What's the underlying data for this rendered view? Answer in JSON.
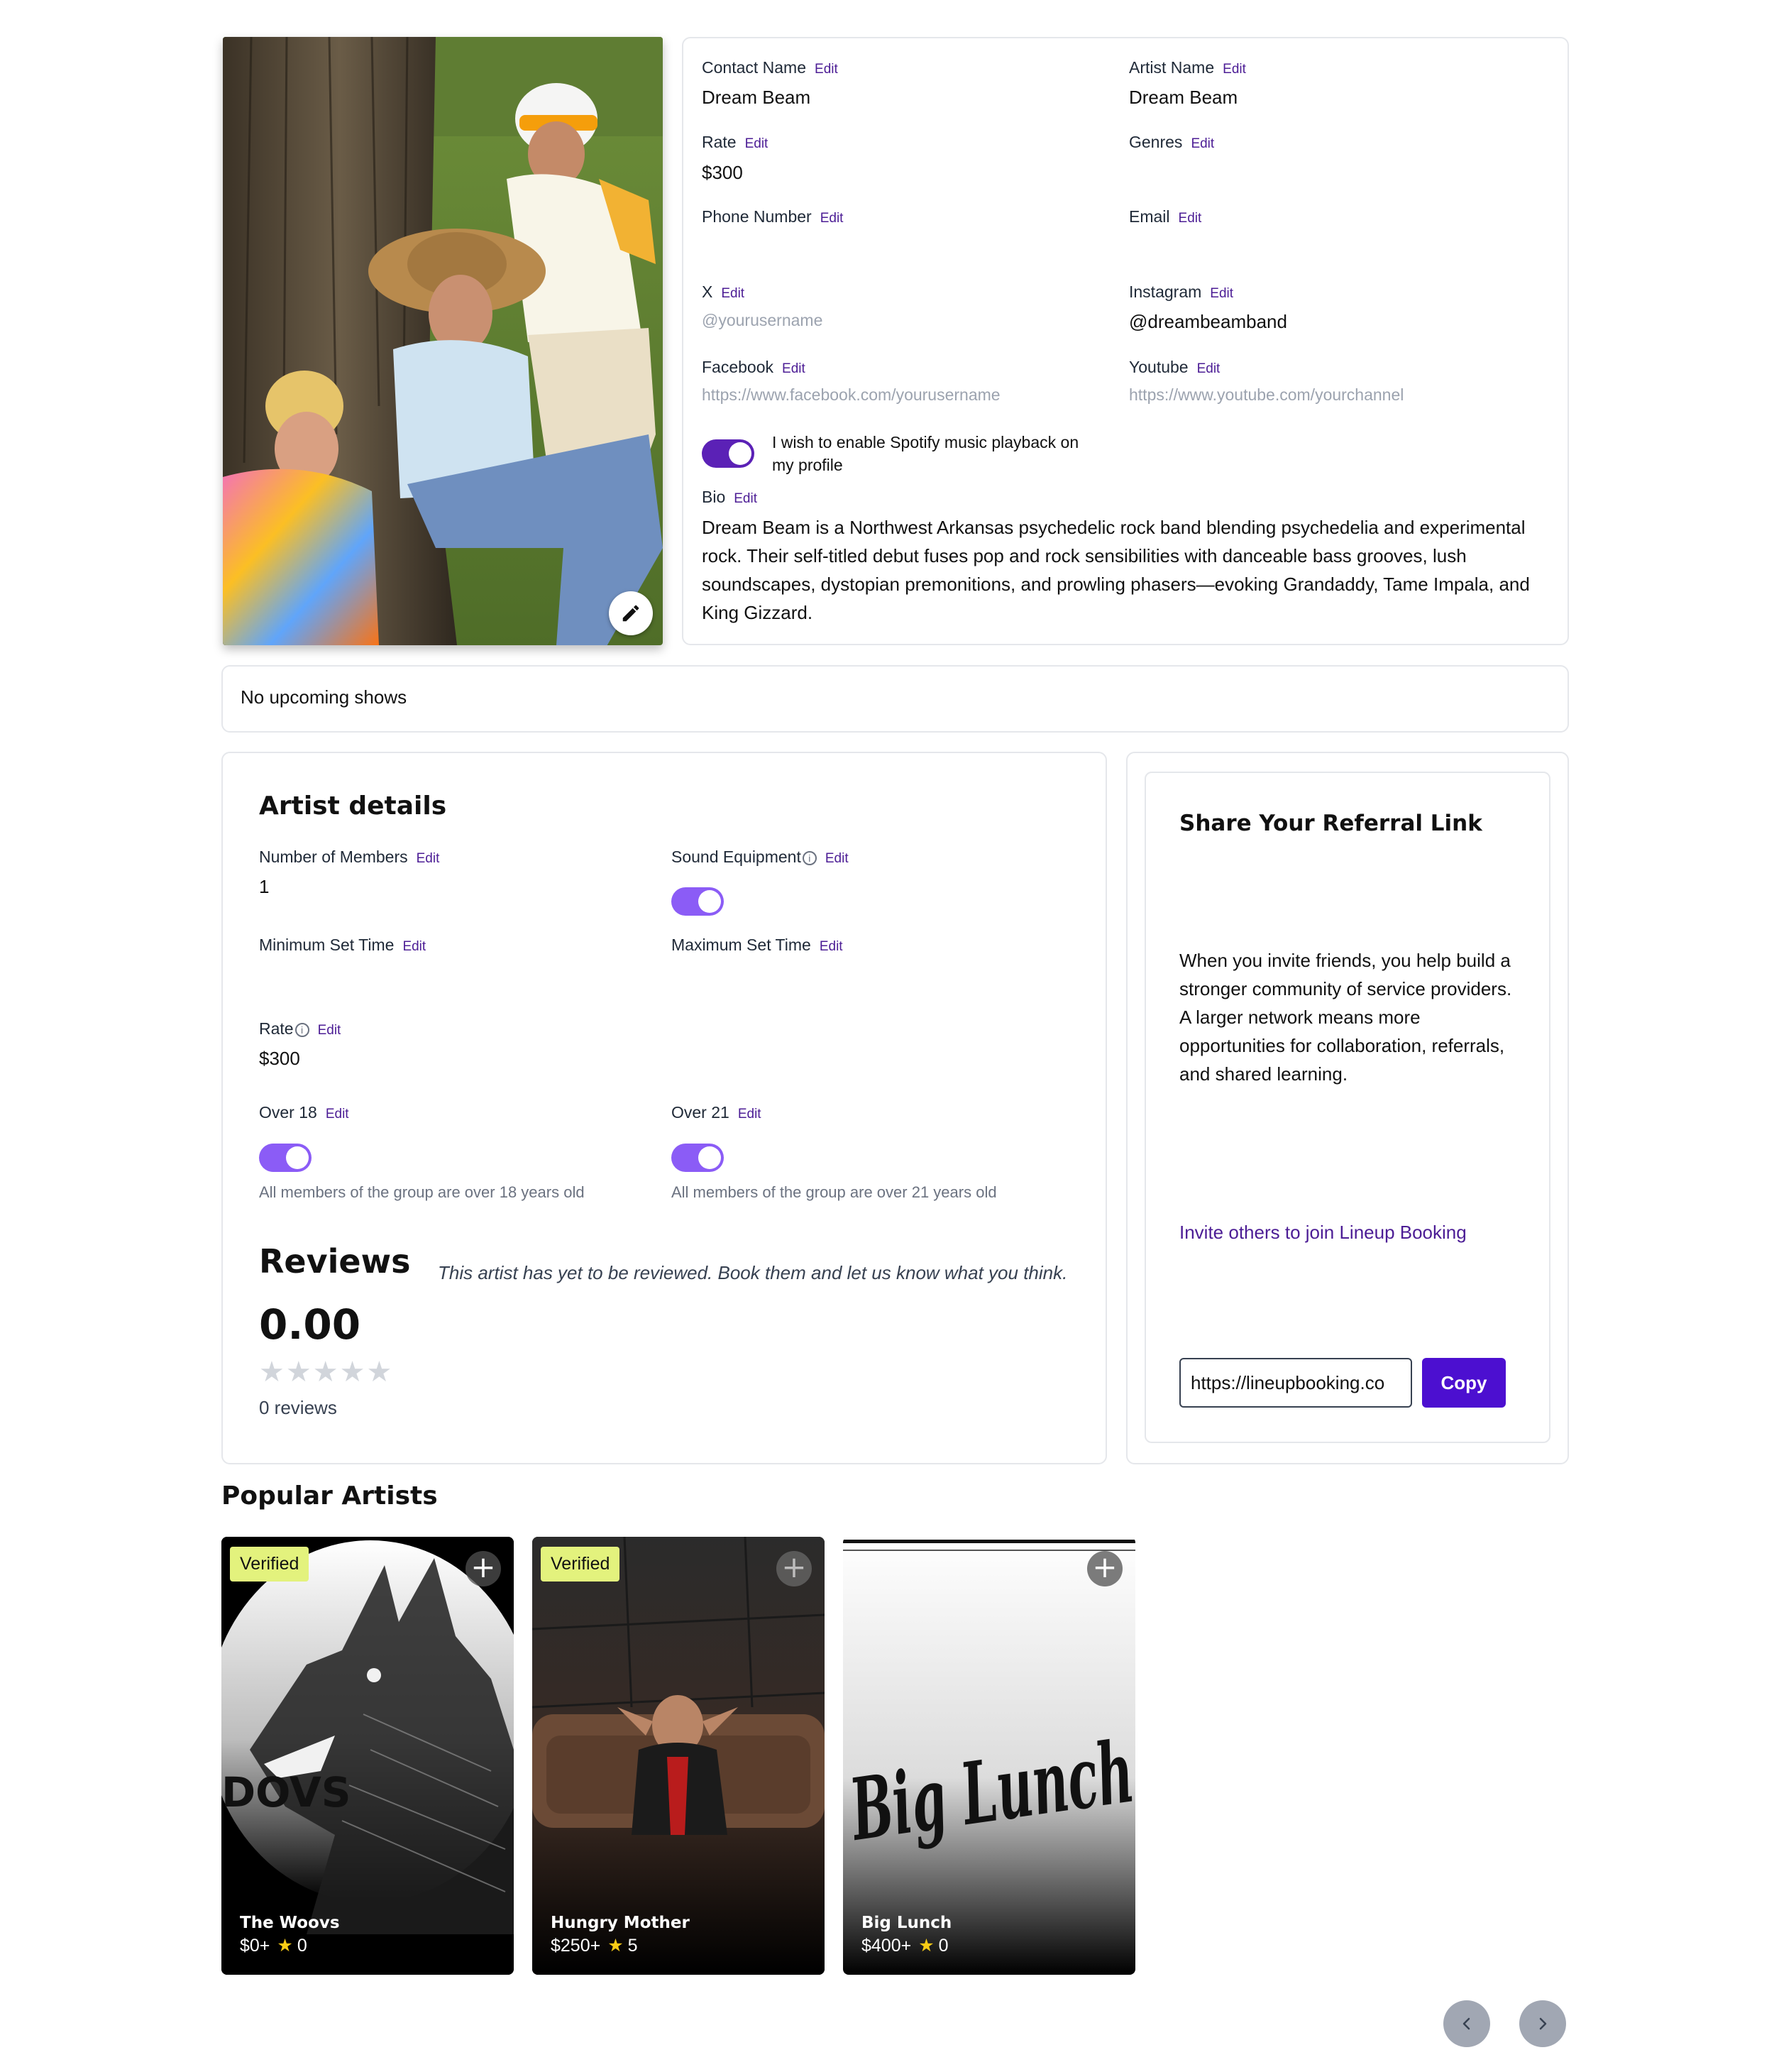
{
  "profile": {
    "photo_edit_icon": "pencil-icon"
  },
  "info": {
    "edit_label": "Edit",
    "contact_name": {
      "label": "Contact Name",
      "value": "Dream Beam"
    },
    "artist_name": {
      "label": "Artist Name",
      "value": "Dream Beam"
    },
    "rate": {
      "label": "Rate",
      "value": "$300"
    },
    "genres": {
      "label": "Genres",
      "value": ""
    },
    "phone": {
      "label": "Phone Number",
      "value": ""
    },
    "email": {
      "label": "Email",
      "value": ""
    },
    "x": {
      "label": "X",
      "placeholder": "@yourusername"
    },
    "instagram": {
      "label": "Instagram",
      "value": "@dreambeamband"
    },
    "facebook": {
      "label": "Facebook",
      "placeholder": "https://www.facebook.com/yourusername"
    },
    "youtube": {
      "label": "Youtube",
      "placeholder": "https://www.youtube.com/yourchannel"
    },
    "spotify_toggle": {
      "line1": "I wish to enable Spotify music playback on",
      "line2": "my profile",
      "enabled": true
    },
    "bio": {
      "label": "Bio",
      "text": "Dream Beam is a Northwest Arkansas psychedelic rock band blending psychedelia and experimental rock. Their self-titled debut fuses pop and rock sensibilities with danceable bass grooves, lush soundscapes, dystopian premonitions, and prowling phasers—evoking Grandaddy, Tame Impala, and King Gizzard."
    }
  },
  "shows": {
    "empty_text": "No upcoming shows"
  },
  "details": {
    "title": "Artist details",
    "members": {
      "label": "Number of Members",
      "value": "1"
    },
    "sound_equipment": {
      "label": "Sound Equipment",
      "enabled": true
    },
    "min_set": {
      "label": "Minimum Set Time",
      "value": ""
    },
    "max_set": {
      "label": "Maximum Set Time",
      "value": ""
    },
    "rate": {
      "label": "Rate",
      "value": "$300"
    },
    "over18": {
      "label": "Over 18",
      "note": "All members of the group are over 18 years old",
      "enabled": true
    },
    "over21": {
      "label": "Over 21",
      "note": "All members of the group are over 21 years old",
      "enabled": true
    },
    "info_icon": "info-circle-icon"
  },
  "reviews": {
    "title": "Reviews",
    "score": "0.00",
    "stars_filled": 0,
    "stars_total": 5,
    "count_text": "0 reviews",
    "empty_text": "This artist has yet to be reviewed. Book them and let us know what you think."
  },
  "referral": {
    "title": "Share Your Referral Link",
    "body": "When you invite friends, you help build a stronger community of service providers. A larger network means more opportunities for collaboration, referrals, and shared learning.",
    "link_text": "Invite others to join Lineup Booking",
    "url_value": "https://lineupbooking.co",
    "copy_label": "Copy"
  },
  "popular": {
    "title": "Popular Artists",
    "verified_label": "Verified",
    "artists": [
      {
        "name": "The Woovs",
        "price": "$0+",
        "rating": "0",
        "verified": true,
        "logo_text": "DOVS"
      },
      {
        "name": "Hungry Mother",
        "price": "$250+",
        "rating": "5",
        "verified": true
      },
      {
        "name": "Big Lunch",
        "price": "$400+",
        "rating": "0",
        "verified": false,
        "logo_text": "Big Lunch"
      }
    ],
    "prev_icon": "chevron-left-icon",
    "next_icon": "chevron-right-icon"
  },
  "colors": {
    "accent": "#4c0fd0",
    "edit_link": "#4c1d95",
    "verified_badge": "#e3f27d",
    "toggle_on": "#5b21b6",
    "toggle_light": "#8b5cf6"
  }
}
